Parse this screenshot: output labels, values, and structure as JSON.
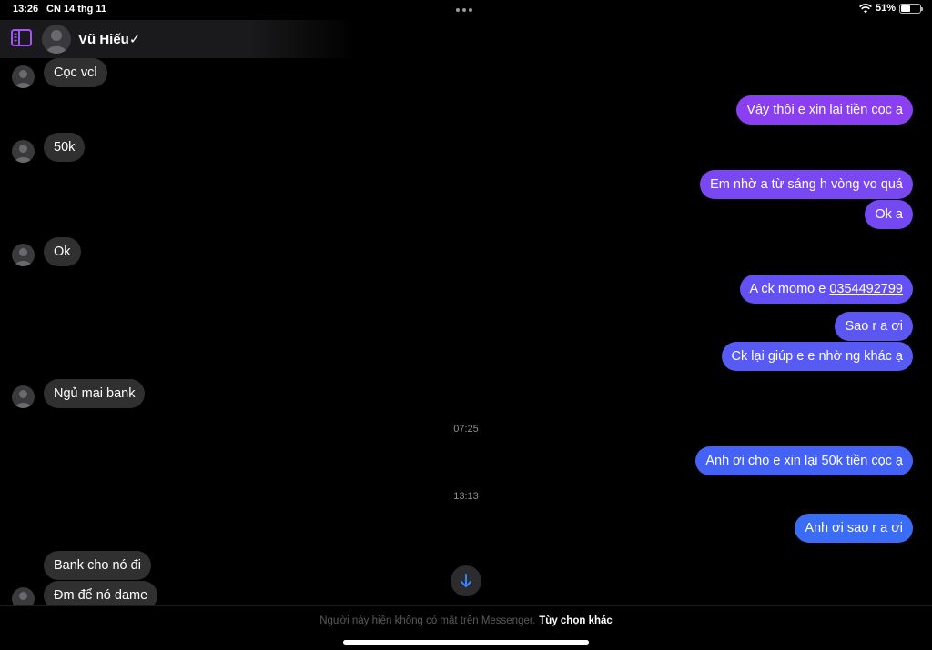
{
  "status_bar": {
    "time": "13:26",
    "date": "CN 14 thg 11",
    "battery": "51%",
    "battery_level": 0.51
  },
  "header": {
    "contact_name": "Vũ Hiếu",
    "verified_mark": "✓"
  },
  "messages": [
    {
      "direction": "in",
      "text": "Cọc vcl"
    },
    {
      "direction": "out",
      "text": "Vậy thôi e xin lại tiền cọc ạ"
    },
    {
      "direction": "in",
      "text": "50k"
    },
    {
      "direction": "out",
      "text": "Em nhờ a từ sáng h vòng vo quá"
    },
    {
      "direction": "out",
      "text": "Ok a"
    },
    {
      "direction": "in",
      "text": "Ok"
    },
    {
      "direction": "out",
      "text": "A ck momo e ",
      "phone": "0354492799"
    },
    {
      "direction": "out",
      "text": "Sao r a ơi"
    },
    {
      "direction": "out",
      "text": "Ck lại giúp e e nhờ ng khác ạ"
    },
    {
      "direction": "in",
      "text": "Ngủ mai bank"
    },
    {
      "direction": "out",
      "text": "Anh ơi cho e xin lại 50k tiền cọc ạ"
    },
    {
      "direction": "out",
      "text": "Anh ơi sao r a ơi"
    },
    {
      "direction": "in",
      "text": "Bank cho nó đi"
    },
    {
      "direction": "in",
      "text": "Đm để nó dame"
    }
  ],
  "timestamps": [
    "07:25",
    "13:13"
  ],
  "footer": {
    "notice": "Người này hiện không có mặt trên Messenger.",
    "options_label": "Tùy chọn khác"
  },
  "colors": {
    "incoming_bubble": "#303030",
    "outgoing_top": "#8a3ff0",
    "outgoing_bottom": "#3b6cf5",
    "accent_icon": "#a155f2",
    "scroll_arrow": "#3a82f7"
  },
  "icons": {
    "sidebar": "sidebar-toggle-icon",
    "scroll": "arrow-down-icon",
    "wifi": "wifi-icon",
    "battery": "battery-icon"
  }
}
